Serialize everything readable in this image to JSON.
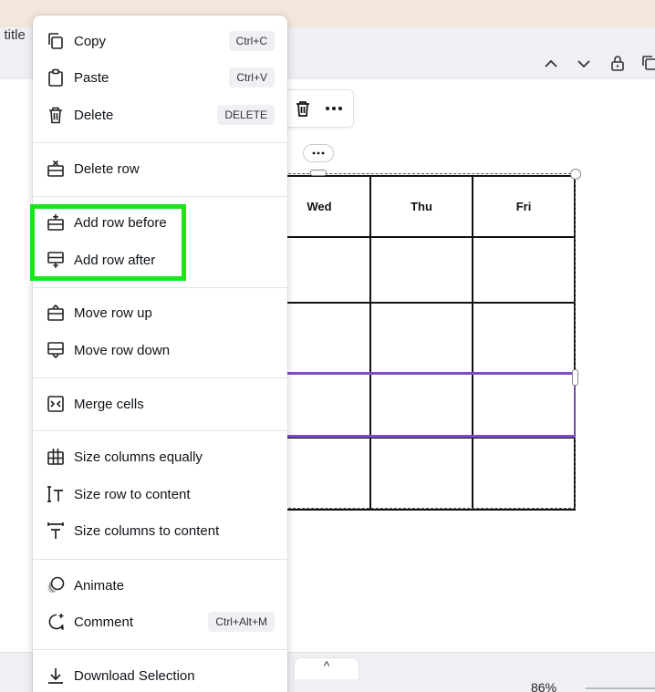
{
  "header": {
    "doc_title_fragment": "e title"
  },
  "table": {
    "headers": [
      "Wed",
      "Thu",
      "Fri"
    ]
  },
  "menu": {
    "items": [
      {
        "label": "Copy",
        "shortcut": "Ctrl+C",
        "icon": "copy-icon"
      },
      {
        "label": "Paste",
        "shortcut": "Ctrl+V",
        "icon": "paste-icon"
      },
      {
        "label": "Delete",
        "shortcut": "DELETE",
        "icon": "trash-icon"
      },
      {
        "label": "Delete row",
        "icon": "delete-row-icon"
      },
      {
        "label": "Add row before",
        "icon": "add-row-before-icon"
      },
      {
        "label": "Add row after",
        "icon": "add-row-after-icon"
      },
      {
        "label": "Move row up",
        "icon": "move-row-up-icon"
      },
      {
        "label": "Move row down",
        "icon": "move-row-down-icon"
      },
      {
        "label": "Merge cells",
        "icon": "merge-cells-icon"
      },
      {
        "label": "Size columns equally",
        "icon": "columns-equal-icon"
      },
      {
        "label": "Size row to content",
        "icon": "row-to-content-icon"
      },
      {
        "label": "Size columns to content",
        "icon": "columns-to-content-icon"
      },
      {
        "label": "Animate",
        "icon": "animate-icon"
      },
      {
        "label": "Comment",
        "shortcut": "Ctrl+Alt+M",
        "icon": "comment-icon"
      },
      {
        "label": "Download Selection",
        "icon": "download-icon"
      }
    ]
  },
  "bottom": {
    "caret": "^",
    "zoom": "86%"
  },
  "colors": {
    "highlight": "#19e619",
    "selection": "#7b4cc7"
  }
}
